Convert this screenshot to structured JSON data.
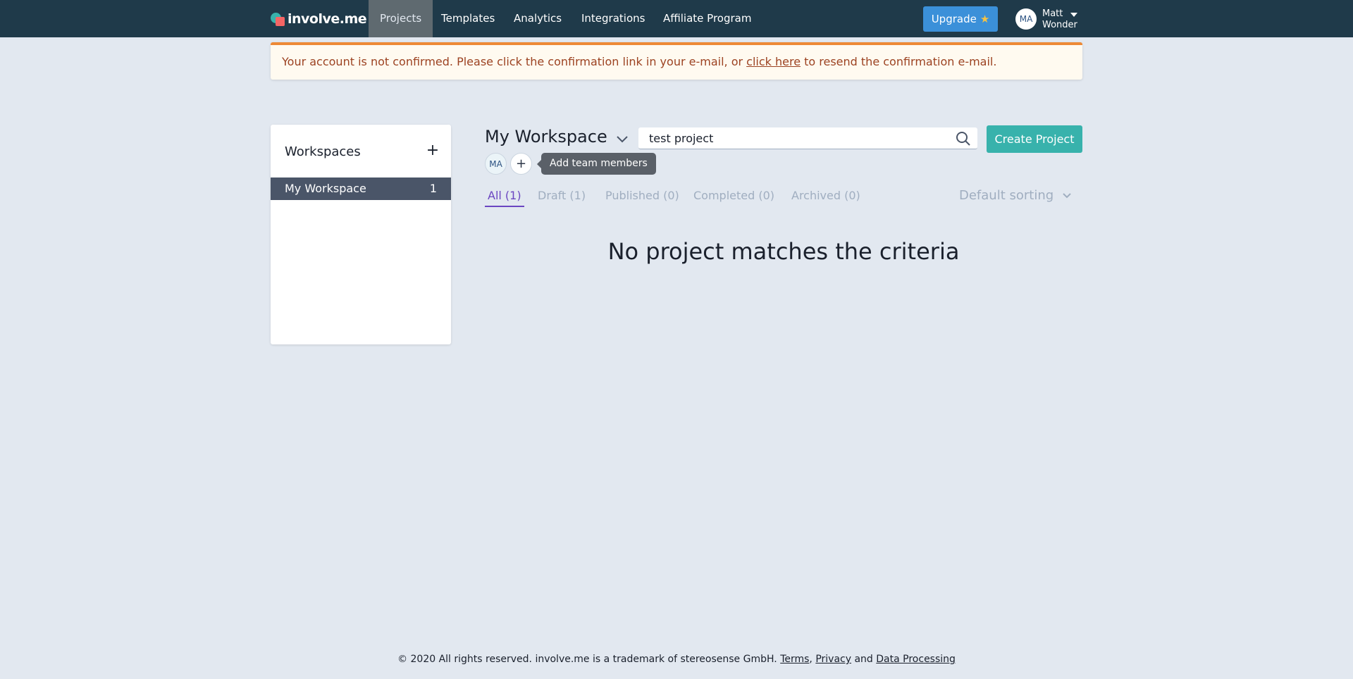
{
  "brand": {
    "logo_text": "involve.me"
  },
  "nav": {
    "items": [
      {
        "label": "Projects",
        "active": true
      },
      {
        "label": "Templates",
        "active": false
      },
      {
        "label": "Analytics",
        "active": false
      },
      {
        "label": "Integrations",
        "active": false
      },
      {
        "label": "Affiliate Program",
        "active": false
      }
    ],
    "upgrade_label": "Upgrade",
    "upgrade_icon": "star-icon",
    "user": {
      "initials": "MA",
      "first_name": "Matt",
      "last_name": "Wonder"
    }
  },
  "alert": {
    "text_before": "Your account is not confirmed. Please click the confirmation link in your e-mail, or ",
    "link_text": "click here",
    "text_after": " to resend the confirmation e-mail.",
    "accent_color": "#ed8936"
  },
  "sidebar": {
    "title": "Workspaces",
    "add_icon": "+",
    "items": [
      {
        "label": "My Workspace",
        "count": "1"
      }
    ]
  },
  "main": {
    "workspace_title": "My Workspace",
    "search": {
      "value": "test project",
      "placeholder": ""
    },
    "create_label": "Create Project",
    "member_initials": "MA",
    "add_member_icon": "+",
    "tooltip": "Add team members",
    "tabs": [
      {
        "label": "All (1)",
        "active": true
      },
      {
        "label": "Draft (1)",
        "active": false
      },
      {
        "label": "Published (0)",
        "active": false
      },
      {
        "label": "Completed (0)",
        "active": false
      },
      {
        "label": "Archived (0)",
        "active": false
      }
    ],
    "sorting_label": "Default sorting",
    "empty_message": "No project matches the criteria"
  },
  "footer": {
    "text": "© 2020 All rights reserved. involve.me is a trademark of stereosense GmbH. ",
    "terms": "Terms",
    "sep1": ", ",
    "privacy": "Privacy",
    "sep2": " and ",
    "data_processing": "Data Processing"
  },
  "colors": {
    "nav_bg": "#1f3a4a",
    "page_bg": "#e2e8f0",
    "teal": "#38b2ac",
    "upgrade_blue": "#3b90d9",
    "tab_active": "#6b46c1"
  }
}
